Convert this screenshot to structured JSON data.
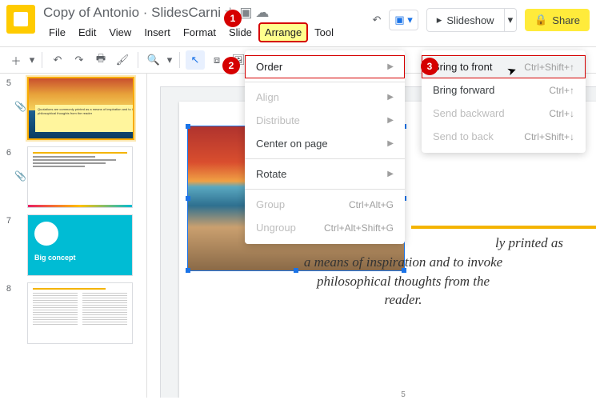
{
  "header": {
    "doc_title": "Copy of Antonio · SlidesCarni",
    "menus": [
      "File",
      "Edit",
      "View",
      "Insert",
      "Format",
      "Slide",
      "Arrange",
      "Tool"
    ],
    "slideshow_label": "Slideshow",
    "share_label": "Share"
  },
  "arrange_menu": {
    "order": "Order",
    "align": "Align",
    "distribute": "Distribute",
    "center": "Center on page",
    "rotate": "Rotate",
    "group": "Group",
    "group_sc": "Ctrl+Alt+G",
    "ungroup": "Ungroup",
    "ungroup_sc": "Ctrl+Alt+Shift+G"
  },
  "order_menu": {
    "front": "Bring to front",
    "front_sc": "Ctrl+Shift+↑",
    "forward": "Bring forward",
    "forward_sc": "Ctrl+↑",
    "backward": "Send backward",
    "backward_sc": "Ctrl+↓",
    "back": "Send to back",
    "back_sc": "Ctrl+Shift+↓"
  },
  "filmstrip": {
    "nums": [
      "5",
      "6",
      "7",
      "8"
    ],
    "big_concept": "Big concept",
    "thumb5_caption": "Quotations are commonly printed as a means of inspiration and to invoke philosophical thoughts from the reader"
  },
  "slide": {
    "text_line1": "ly printed as",
    "text_line2": "a means of inspiration and to invoke",
    "text_line3": "philosophical thoughts from the",
    "text_line4": "reader.",
    "page_num": "5"
  },
  "badges": {
    "b1": "1",
    "b2": "2",
    "b3": "3"
  }
}
